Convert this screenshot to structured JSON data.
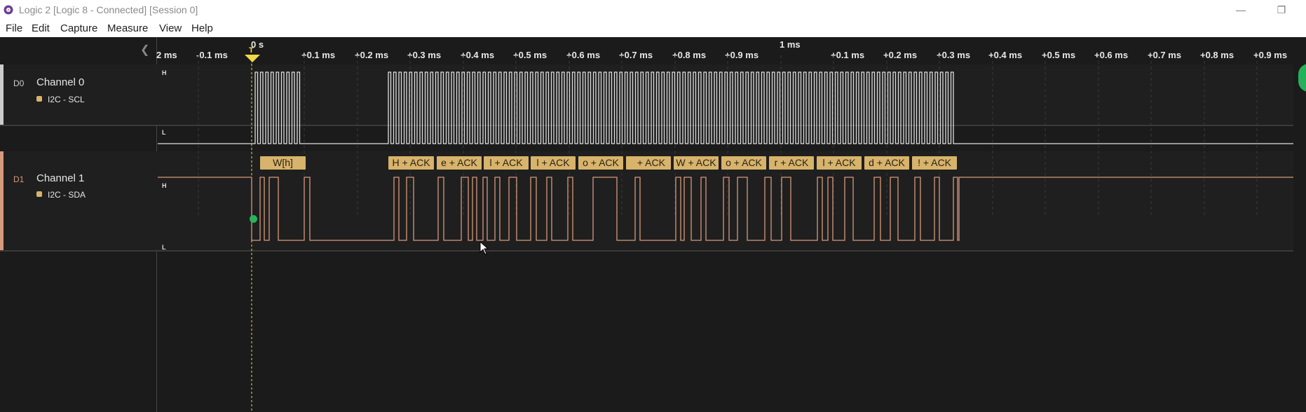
{
  "window": {
    "title": "Logic 2 [Logic 8 - Connected] [Session 0]",
    "minimize": "—",
    "restore": "❐",
    "app_icon": "gear-icon"
  },
  "menu": [
    "File",
    "Edit",
    "Capture",
    "Measure",
    "View",
    "Help"
  ],
  "timeline": {
    "zero_label": "0 s",
    "major_label": "1 ms",
    "ticks": [
      "2 ms",
      "-0.1 ms",
      "+0.1 ms",
      "+0.2 ms",
      "+0.3 ms",
      "+0.4 ms",
      "+0.5 ms",
      "+0.6 ms",
      "+0.7 ms",
      "+0.8 ms",
      "+0.9 ms",
      "+0.1 ms",
      "+0.2 ms",
      "+0.3 ms",
      "+0.4 ms",
      "+0.5 ms",
      "+0.6 ms",
      "+0.7 ms",
      "+0.8 ms",
      "+0.9 ms"
    ],
    "trigger_label": "T"
  },
  "channels": [
    {
      "id": "D0",
      "name": "Channel 0",
      "analyzer": "I2C - SCL",
      "high": "H",
      "low": "L",
      "color": "#cccccc"
    },
    {
      "id": "D1",
      "name": "Channel 1",
      "analyzer": "I2C - SDA",
      "high": "H",
      "low": "L",
      "color": "#d79a7a"
    }
  ],
  "decoded": [
    "W[h]",
    "H + ACK",
    "e + ACK",
    "l + ACK",
    "l + ACK",
    "o + ACK",
    "  + ACK",
    "W + ACK",
    "o + ACK",
    "r + ACK",
    "l + ACK",
    "d + ACK",
    "! + ACK"
  ],
  "colors": {
    "analyzer": "#d7b36b",
    "trigger": "#f0d84a",
    "sda": "#d79a7a",
    "scl": "#e0e0e0"
  }
}
